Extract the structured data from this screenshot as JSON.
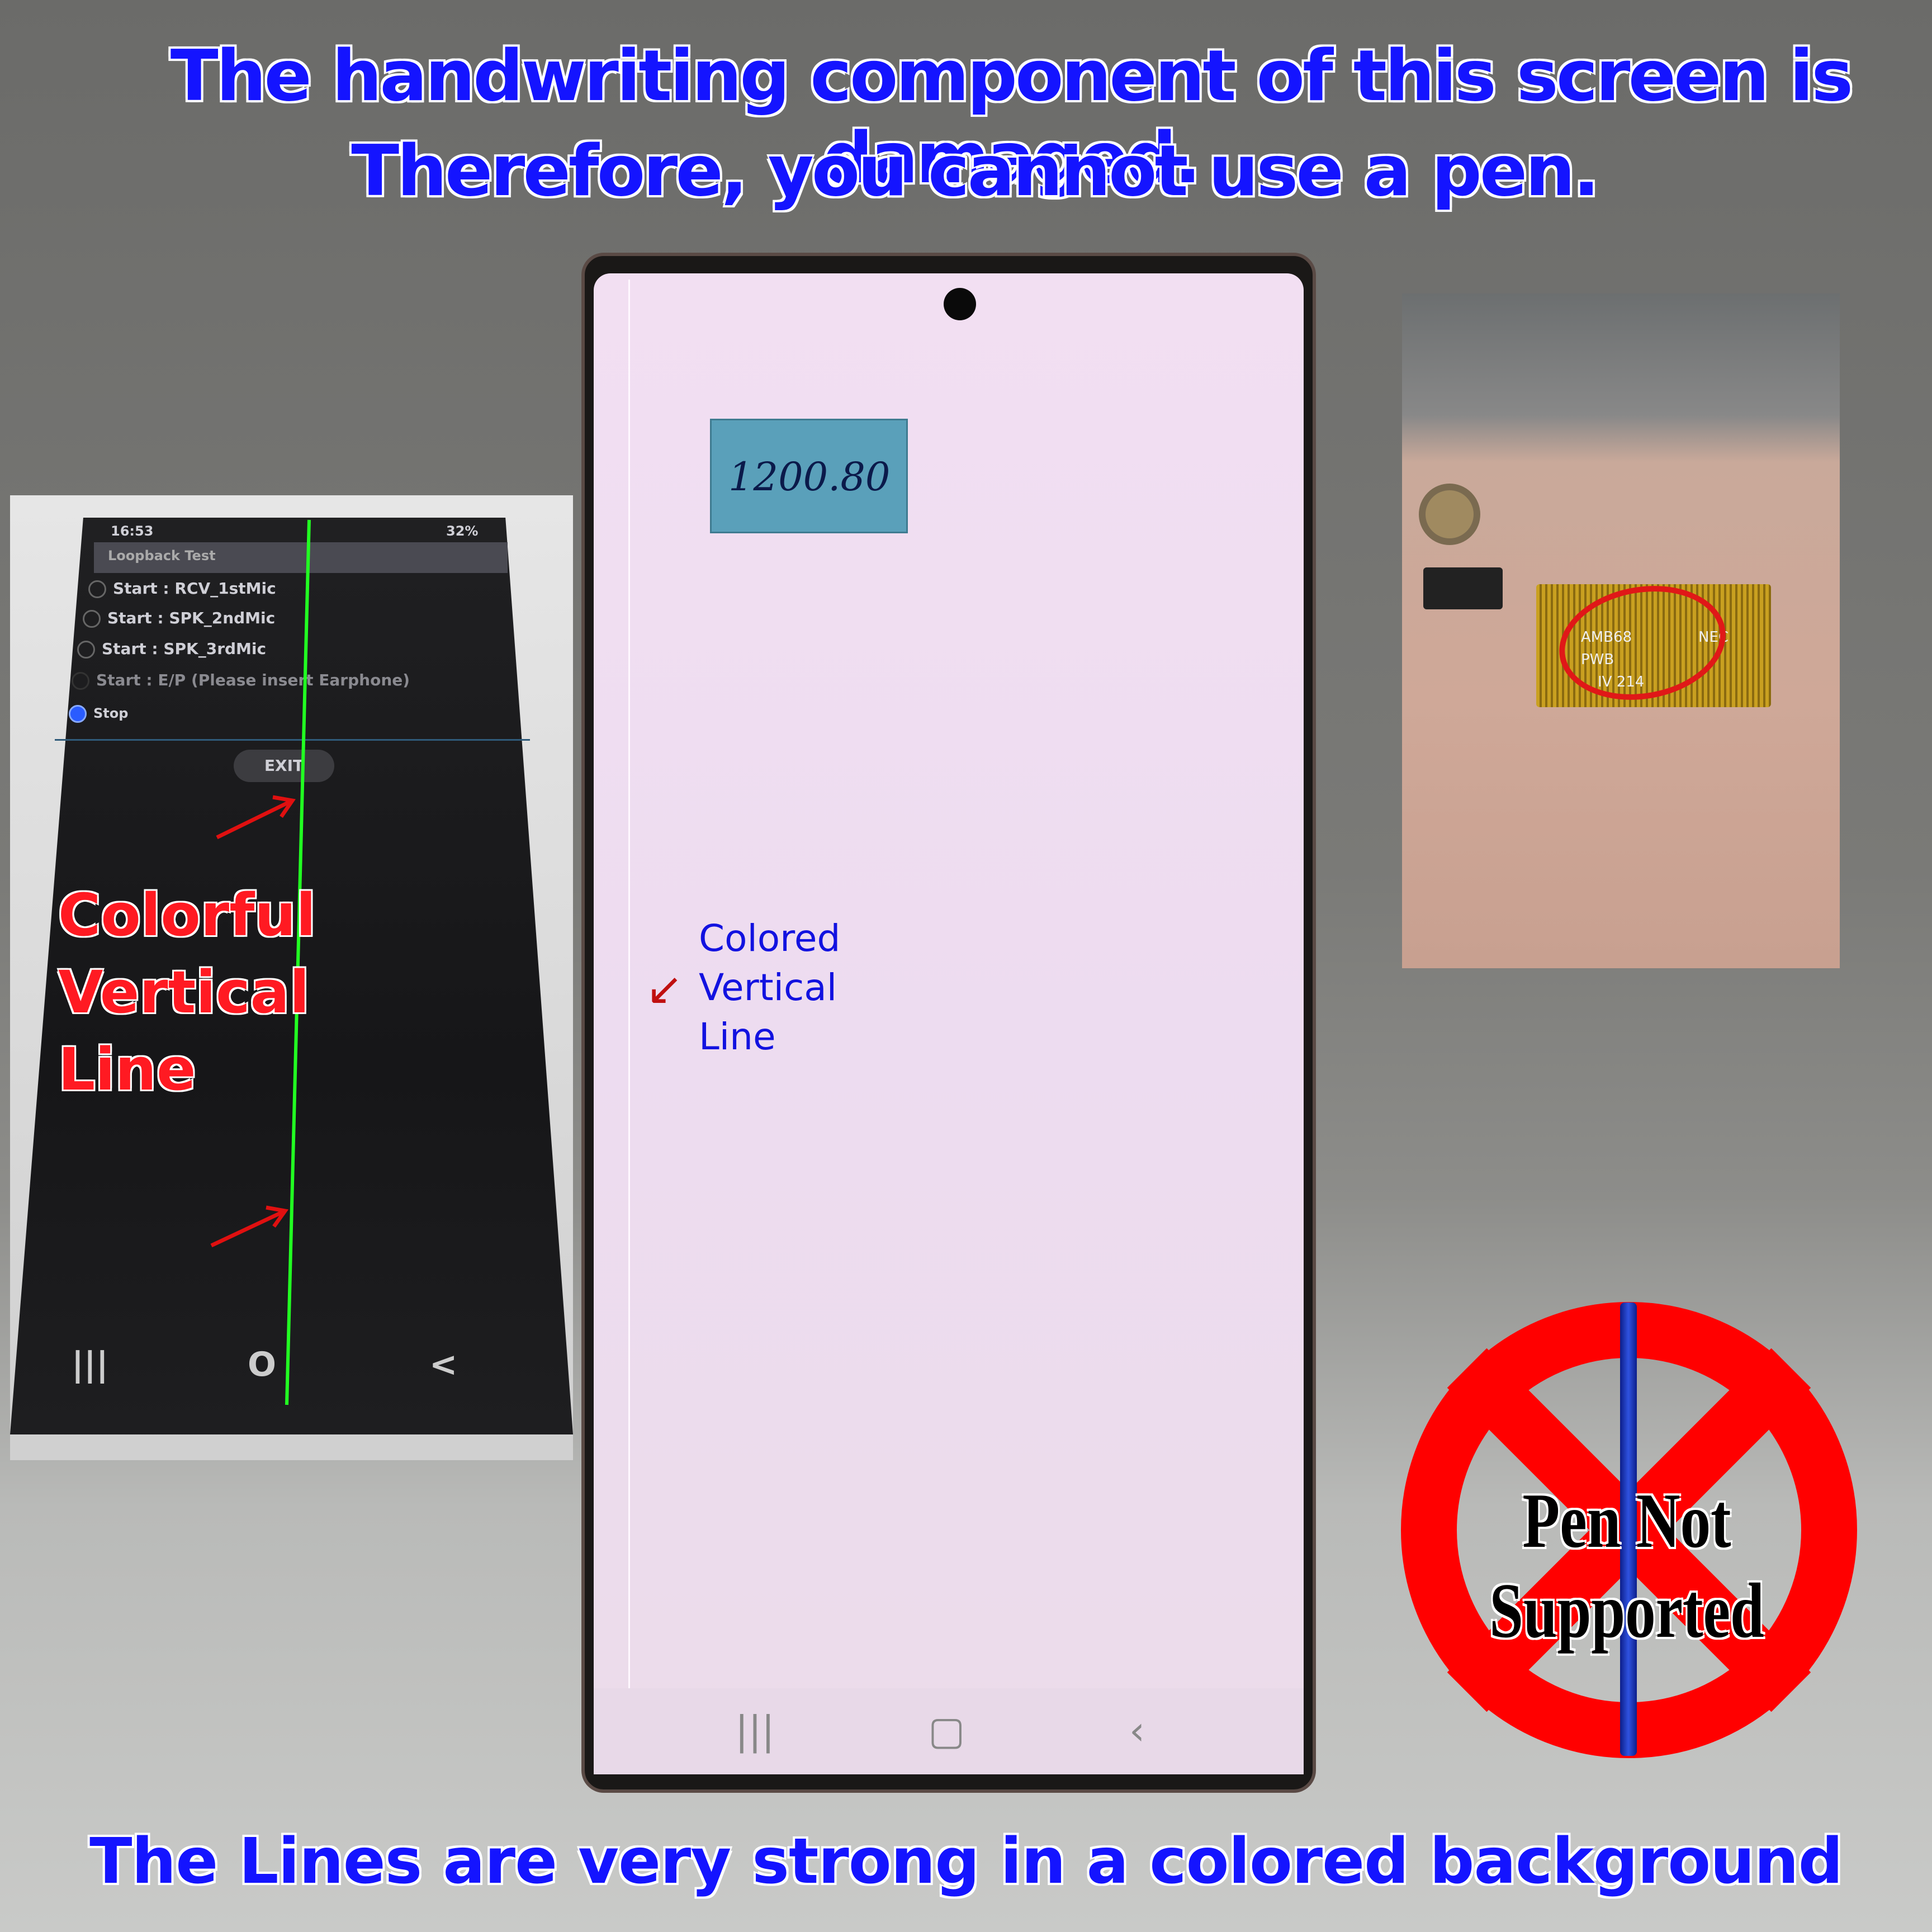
{
  "headline": {
    "line1": "The handwriting component of this screen is damaged.",
    "line2": "Therefore, you cannot use a pen."
  },
  "bottom_caption": "The Lines are very strong in a colored background",
  "main_phone": {
    "sticker_text": "1200.80",
    "annotation": [
      "Colored",
      "Vertical",
      "Line"
    ],
    "nav": {
      "recent": "|||",
      "home": "▢",
      "back": "‹"
    }
  },
  "left_inset": {
    "status": {
      "time": "16:53",
      "battery": "32%"
    },
    "app_title": "Loopback Test",
    "options": [
      {
        "label": "Start : RCV_1stMic",
        "selected": false
      },
      {
        "label": "Start : SPK_2ndMic",
        "selected": false
      },
      {
        "label": "Start : SPK_3rdMic",
        "selected": false
      },
      {
        "label": "Start : E/P (Please insert Earphone)",
        "selected": false,
        "disabled": true
      },
      {
        "label": "Stop",
        "selected": true
      }
    ],
    "exit_label": "EXIT",
    "callout": [
      "Colorful",
      "Vertical",
      "Line"
    ],
    "nav": {
      "recent": "|||",
      "home": "O",
      "back": "<"
    },
    "line_color": "#22ff22"
  },
  "right_inset": {
    "flex_text": [
      "AMB68",
      "PWB",
      "IV 214",
      "NEC"
    ]
  },
  "sign": {
    "text": "Pen Not Supported",
    "color": "#ff0000"
  },
  "colors": {
    "headline": "#1414ff",
    "callout": "#ff1a22"
  }
}
